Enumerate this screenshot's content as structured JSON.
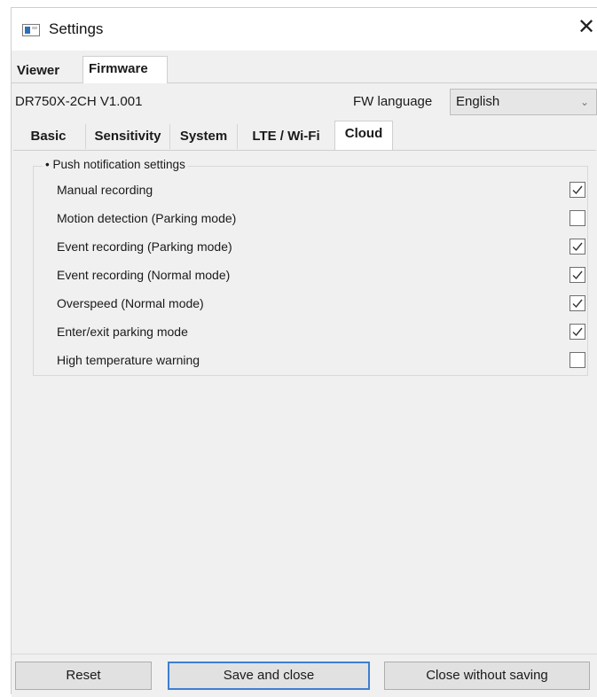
{
  "window": {
    "title": "Settings",
    "icon": "app-window-icon",
    "close_glyph": "✕"
  },
  "top_tabs": [
    {
      "label": "Viewer",
      "active": false
    },
    {
      "label": "Firmware",
      "active": true
    }
  ],
  "firmware": {
    "model_version": "DR750X-2CH  V1.001",
    "fw_language_label": "FW language",
    "fw_language_value": "English"
  },
  "sub_tabs": [
    {
      "label": "Basic",
      "active": false
    },
    {
      "label": "Sensitivity",
      "active": false
    },
    {
      "label": "System",
      "active": false
    },
    {
      "label": "LTE / Wi-Fi",
      "active": false
    },
    {
      "label": "Cloud",
      "active": true
    }
  ],
  "push_group": {
    "title": "• Push notification settings",
    "items": [
      {
        "label": "Manual recording",
        "checked": true
      },
      {
        "label": "Motion detection (Parking mode)",
        "checked": false
      },
      {
        "label": "Event recording (Parking mode)",
        "checked": true
      },
      {
        "label": "Event recording (Normal mode)",
        "checked": true
      },
      {
        "label": "Overspeed (Normal mode)",
        "checked": true
      },
      {
        "label": "Enter/exit parking mode",
        "checked": true
      },
      {
        "label": "High temperature warning",
        "checked": false
      }
    ]
  },
  "buttons": {
    "reset": "Reset",
    "save": "Save and close",
    "close": "Close without saving"
  },
  "colors": {
    "accent_border": "#3c7fd1",
    "background": "#f0f0f0"
  }
}
